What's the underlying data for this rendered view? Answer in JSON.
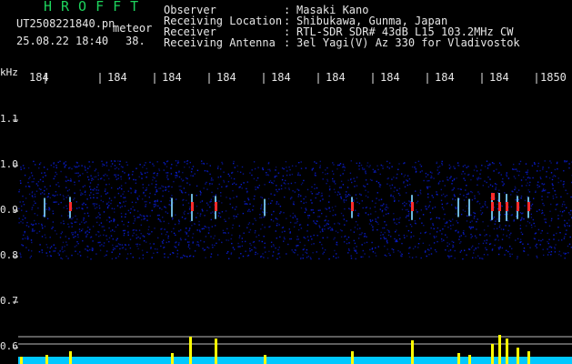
{
  "header": {
    "logo": "HROFFT",
    "filename": "UT2508221840.pn",
    "tag": "meteor",
    "datetime": "25.08.22 18:40",
    "count": "38."
  },
  "info": [
    {
      "label": "Observer",
      "value": "Masaki Kano"
    },
    {
      "label": "Receiving Location",
      "value": "Shibukawa, Gunma, Japan"
    },
    {
      "label": "Receiver",
      "value": "RTL-SDR SDR# 43dB L15 103.2MHz CW"
    },
    {
      "label": "Receiving Antenna",
      "value": "3el Yagi(V) Az 330 for Vladivostok"
    }
  ],
  "axes": {
    "y_unit": "kHz",
    "x_ticks": [
      "184",
      "184",
      "184",
      "184",
      "184",
      "184",
      "184",
      "184",
      "184",
      "1850"
    ],
    "y_ticks": [
      "1.1",
      "1.0",
      "0.9",
      "0.8",
      "0.7",
      "0.6"
    ]
  },
  "colors": {
    "background": "#000000",
    "noise": "#1a2fd6",
    "signal": "#ff2a2a",
    "level": "#ffff00",
    "baseline": "#00c8ff",
    "logo": "#1dd35c"
  }
}
